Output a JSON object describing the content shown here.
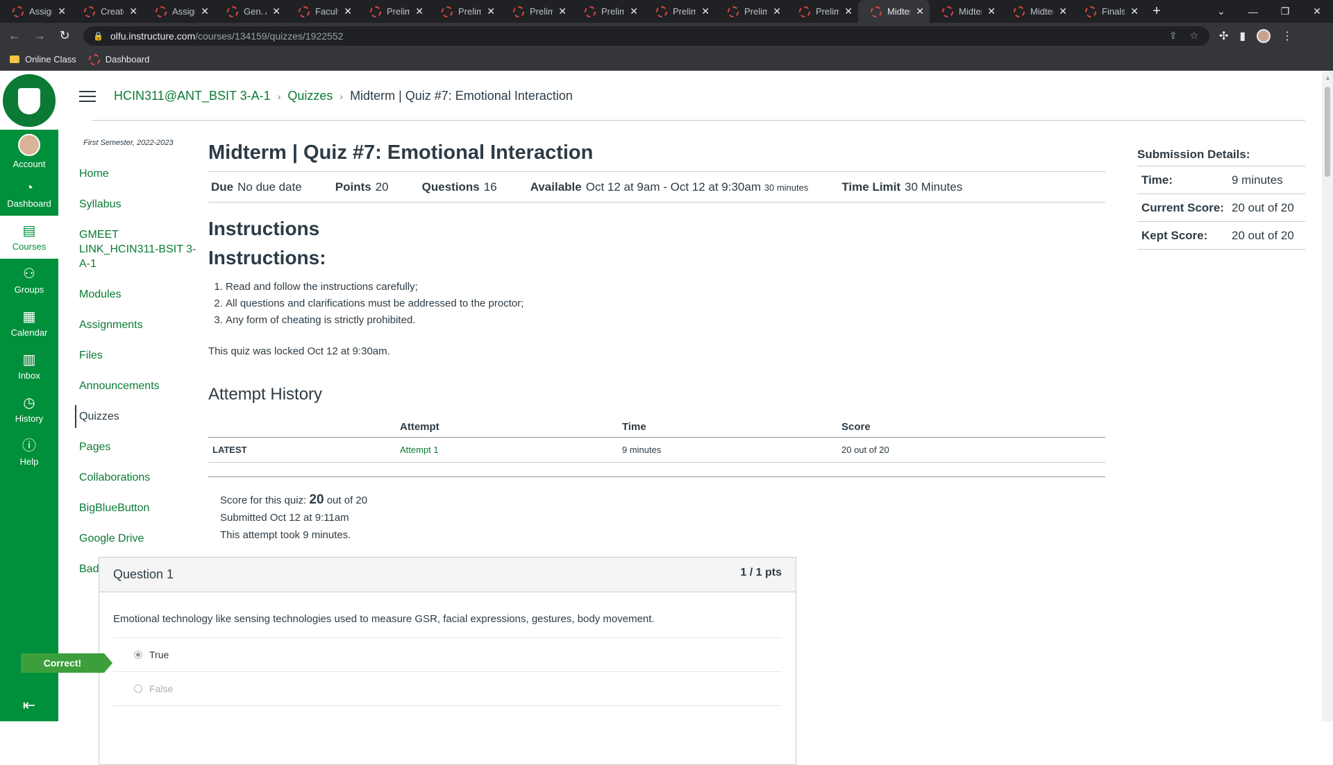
{
  "browser": {
    "tabs": [
      {
        "label": "Assign"
      },
      {
        "label": "Create"
      },
      {
        "label": "Assign"
      },
      {
        "label": "Gen. A"
      },
      {
        "label": "Faculty"
      },
      {
        "label": "Prelim"
      },
      {
        "label": "Prelim"
      },
      {
        "label": "Prelim"
      },
      {
        "label": "Prelim"
      },
      {
        "label": "Prelim"
      },
      {
        "label": "Prelim"
      },
      {
        "label": "Prelim"
      },
      {
        "label": "Midter"
      },
      {
        "label": "Midter"
      },
      {
        "label": "Midter"
      },
      {
        "label": "Finals"
      }
    ],
    "active_tab_index": 12,
    "url_host": "olfu.instructure.com",
    "url_path": "/courses/134159/quizzes/1922552",
    "bookmarks": [
      {
        "label": "Online Class",
        "icon": "folder-icon"
      },
      {
        "label": "Dashboard",
        "icon": "canvas-icon"
      }
    ]
  },
  "global_nav": {
    "items": [
      {
        "label": "Account",
        "icon": "avatar"
      },
      {
        "label": "Dashboard",
        "icon": "dashboard-icon"
      },
      {
        "label": "Courses",
        "icon": "courses-icon"
      },
      {
        "label": "Groups",
        "icon": "groups-icon"
      },
      {
        "label": "Calendar",
        "icon": "calendar-icon"
      },
      {
        "label": "Inbox",
        "icon": "inbox-icon"
      },
      {
        "label": "History",
        "icon": "history-icon"
      },
      {
        "label": "Help",
        "icon": "help-icon"
      }
    ],
    "active_item": "Courses"
  },
  "breadcrumb": {
    "course": "HCIN311@ANT_BSIT 3-A-1",
    "section": "Quizzes",
    "current": "Midterm | Quiz #7: Emotional Interaction"
  },
  "course_nav": {
    "term": "First Semester, 2022-2023",
    "items": [
      "Home",
      "Syllabus",
      "GMEET LINK_HCIN311-BSIT 3-A-1",
      "Modules",
      "Assignments",
      "Files",
      "Announcements",
      "Quizzes",
      "Pages",
      "Collaborations",
      "BigBlueButton",
      "Google Drive",
      "Badges"
    ],
    "active_item": "Quizzes"
  },
  "quiz": {
    "title": "Midterm | Quiz #7: Emotional Interaction",
    "due_label": "Due",
    "due_value": "No due date",
    "points_label": "Points",
    "points_value": "20",
    "questions_label": "Questions",
    "questions_value": "16",
    "available_label": "Available",
    "available_value": "Oct 12 at 9am - Oct 12 at 9:30am",
    "available_duration": "30 minutes",
    "time_limit_label": "Time Limit",
    "time_limit_value": "30 Minutes",
    "instructions_heading": "Instructions",
    "instructions_subheading": "Instructions:",
    "rules": [
      "Read and follow the instructions carefully;",
      "All questions and clarifications must be addressed to the proctor;",
      "Any form of cheating is strictly prohibited."
    ],
    "locked_note": "This quiz was locked Oct 12 at 9:30am."
  },
  "attempt_history": {
    "heading": "Attempt History",
    "columns": [
      "",
      "Attempt",
      "Time",
      "Score"
    ],
    "rows": [
      {
        "tag": "LATEST",
        "attempt": "Attempt 1",
        "time": "9 minutes",
        "score": "20 out of 20"
      }
    ]
  },
  "result": {
    "score_prefix": "Score for this quiz:",
    "score": "20",
    "score_suffix": "out of 20",
    "submitted": "Submitted Oct 12 at 9:11am",
    "duration": "This attempt took 9 minutes."
  },
  "question": {
    "title": "Question 1",
    "points": "1 / 1 pts",
    "text": "Emotional technology like sensing technologies used to measure GSR, facial expressions, gestures, body movement.",
    "correct_label": "Correct!",
    "options": [
      {
        "label": "True",
        "selected": true
      },
      {
        "label": "False",
        "selected": false
      }
    ]
  },
  "submission_details": {
    "title": "Submission Details:",
    "rows": [
      {
        "label": "Time:",
        "value": "9 minutes"
      },
      {
        "label": "Current Score:",
        "value": "20 out of 20"
      },
      {
        "label": "Kept Score:",
        "value": "20 out of 20"
      }
    ]
  },
  "colors": {
    "brand": "#008f3a",
    "link": "#0a7a34",
    "correct": "#3c9f3c"
  }
}
